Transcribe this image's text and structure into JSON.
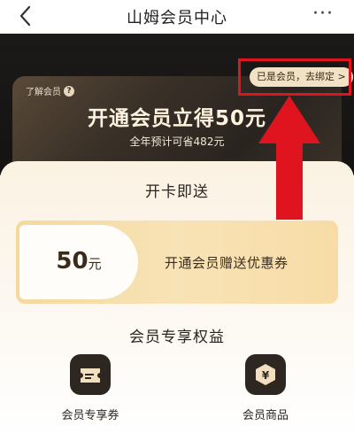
{
  "nav": {
    "title": "山姆会员中心",
    "back_icon": "chevron-left-icon",
    "more_icon": "more-dots-icon"
  },
  "card": {
    "learn_label": "了解会员",
    "learn_icon": "question-icon",
    "bind_label": "已是会员，去绑定 >",
    "headline": "开通会员立得50元",
    "subline": "全年预计可省482元"
  },
  "gift": {
    "title": "开卡即送",
    "coupon": {
      "amount": "50",
      "unit": "元",
      "description": "开通会员赠送优惠券"
    }
  },
  "benefits": {
    "title": "会员专享权益",
    "items": [
      {
        "label": "会员专享券",
        "icon": "ticket-icon"
      },
      {
        "label": "会员商品",
        "icon": "yen-shield-icon"
      }
    ]
  },
  "colors": {
    "annotation_red": "#e0141e",
    "card_dark": "#2a2420",
    "gold": "#f4d99f"
  }
}
